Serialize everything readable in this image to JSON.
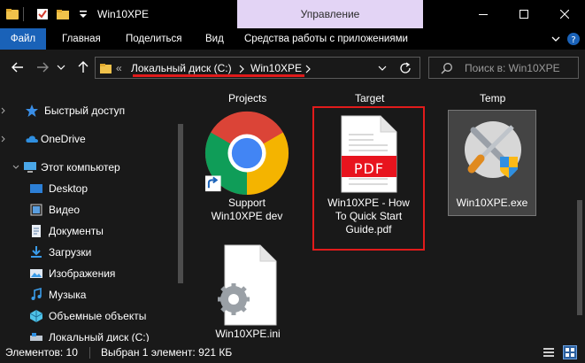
{
  "window": {
    "title": "Win10XPE",
    "manage_tab": "Управление"
  },
  "ribbon": {
    "tabs": [
      "Файл",
      "Главная",
      "Поделиться",
      "Вид",
      "Средства работы с приложениями"
    ]
  },
  "address": {
    "crumbs": [
      "Локальный диск (C:)",
      "Win10XPE"
    ],
    "search_placeholder": "Поиск в: Win10XPE"
  },
  "nav": {
    "items": [
      {
        "label": "Быстрый доступ",
        "icon": "star-icon"
      },
      {
        "label": "OneDrive",
        "icon": "cloud-icon"
      },
      {
        "label": "Этот компьютер",
        "icon": "computer-icon"
      },
      {
        "label": "Desktop",
        "icon": "desktop-folder-icon"
      },
      {
        "label": "Видео",
        "icon": "video-folder-icon"
      },
      {
        "label": "Документы",
        "icon": "documents-folder-icon"
      },
      {
        "label": "Загрузки",
        "icon": "downloads-folder-icon"
      },
      {
        "label": "Изображения",
        "icon": "pictures-folder-icon"
      },
      {
        "label": "Музыка",
        "icon": "music-folder-icon"
      },
      {
        "label": "Объемные объекты",
        "icon": "3d-objects-icon"
      },
      {
        "label": "Локальный диск (C:)",
        "icon": "drive-icon"
      }
    ]
  },
  "content": {
    "column_headers": [
      "Projects",
      "Target",
      "Temp"
    ],
    "files": [
      {
        "name_lines": [
          "Support",
          "Win10XPE dev"
        ],
        "icon": "chrome-shortcut-icon"
      },
      {
        "name_lines": [
          "Win10XPE - How",
          "To Quick Start",
          "Guide.pdf"
        ],
        "icon": "pdf-file-icon",
        "icon_text": "PDF"
      },
      {
        "name_lines": [
          "Win10XPE.exe"
        ],
        "icon": "exe-tools-icon"
      },
      {
        "name_lines": [
          "Win10XPE.ini"
        ],
        "icon": "ini-settings-icon"
      }
    ]
  },
  "status": {
    "count": "Элементов: 10",
    "selection": "Выбран 1 элемент: 921 КБ"
  },
  "colors": {
    "accent": "#1a62b8",
    "manage_tab": "#e3d4f5",
    "highlight_red": "#e11b1b",
    "background": "#191919"
  }
}
